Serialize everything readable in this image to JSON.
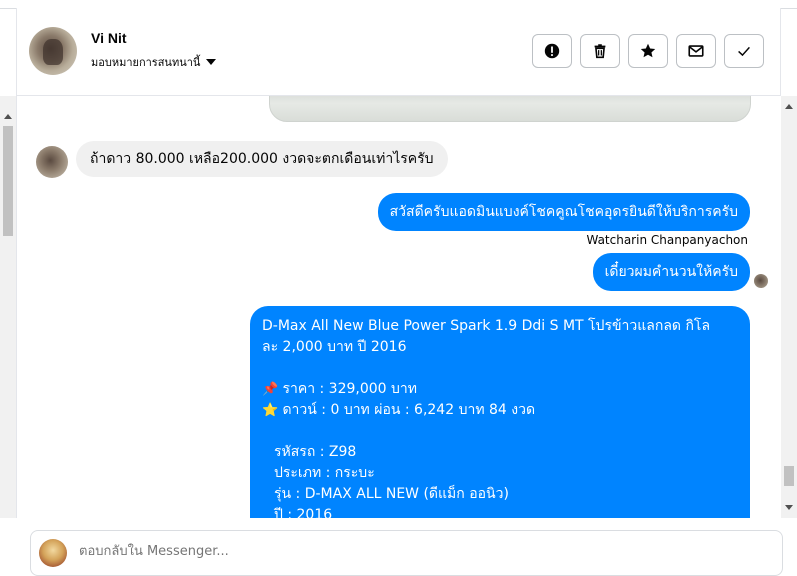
{
  "header": {
    "name": "Vi Nit",
    "assign_label": "มอบหมายการสนทนานี้",
    "actions": [
      {
        "icon": "alert-icon"
      },
      {
        "icon": "trash-icon"
      },
      {
        "icon": "star-icon"
      },
      {
        "icon": "envelope-icon"
      },
      {
        "icon": "check-icon"
      }
    ]
  },
  "messages": {
    "incoming_1": "ถ้าดาว 80.000 เหลือ200.000 งวดจะตกเดือนเท่าไรครับ",
    "outgoing_1": "สวัสดีครับแอดมินแบงค์โชคคูณโชคอุดรยินดีให้บริการครับ",
    "sender_name": "Watcharin Chanpanyachon",
    "outgoing_2": "เดี๋ยวผมคำนวนให้ครับ",
    "outgoing_3": {
      "line1": "D-Max All New Blue Power Spark 1.9 Ddi S MT โปรข้าวแลกลด กิโล",
      "line2": "ละ 2,000 บาท ปี 2016",
      "price": "ราคา : 329,000 บาท",
      "down": "ดาวน์ : 0 บาท ผ่อน : 6,242 บาท 84 งวด",
      "code": "รหัสรถ : Z98",
      "type": "ประเภท : กระบะ",
      "model": "รุ่น : D-MAX ALL NEW (ดีแม็ก ออนิว)",
      "year": "ปี : 2016"
    }
  },
  "composer": {
    "placeholder": "ตอบกลับใน Messenger..."
  },
  "colors": {
    "accent": "#0084ff",
    "incoming_bubble": "#f0f0f0"
  }
}
